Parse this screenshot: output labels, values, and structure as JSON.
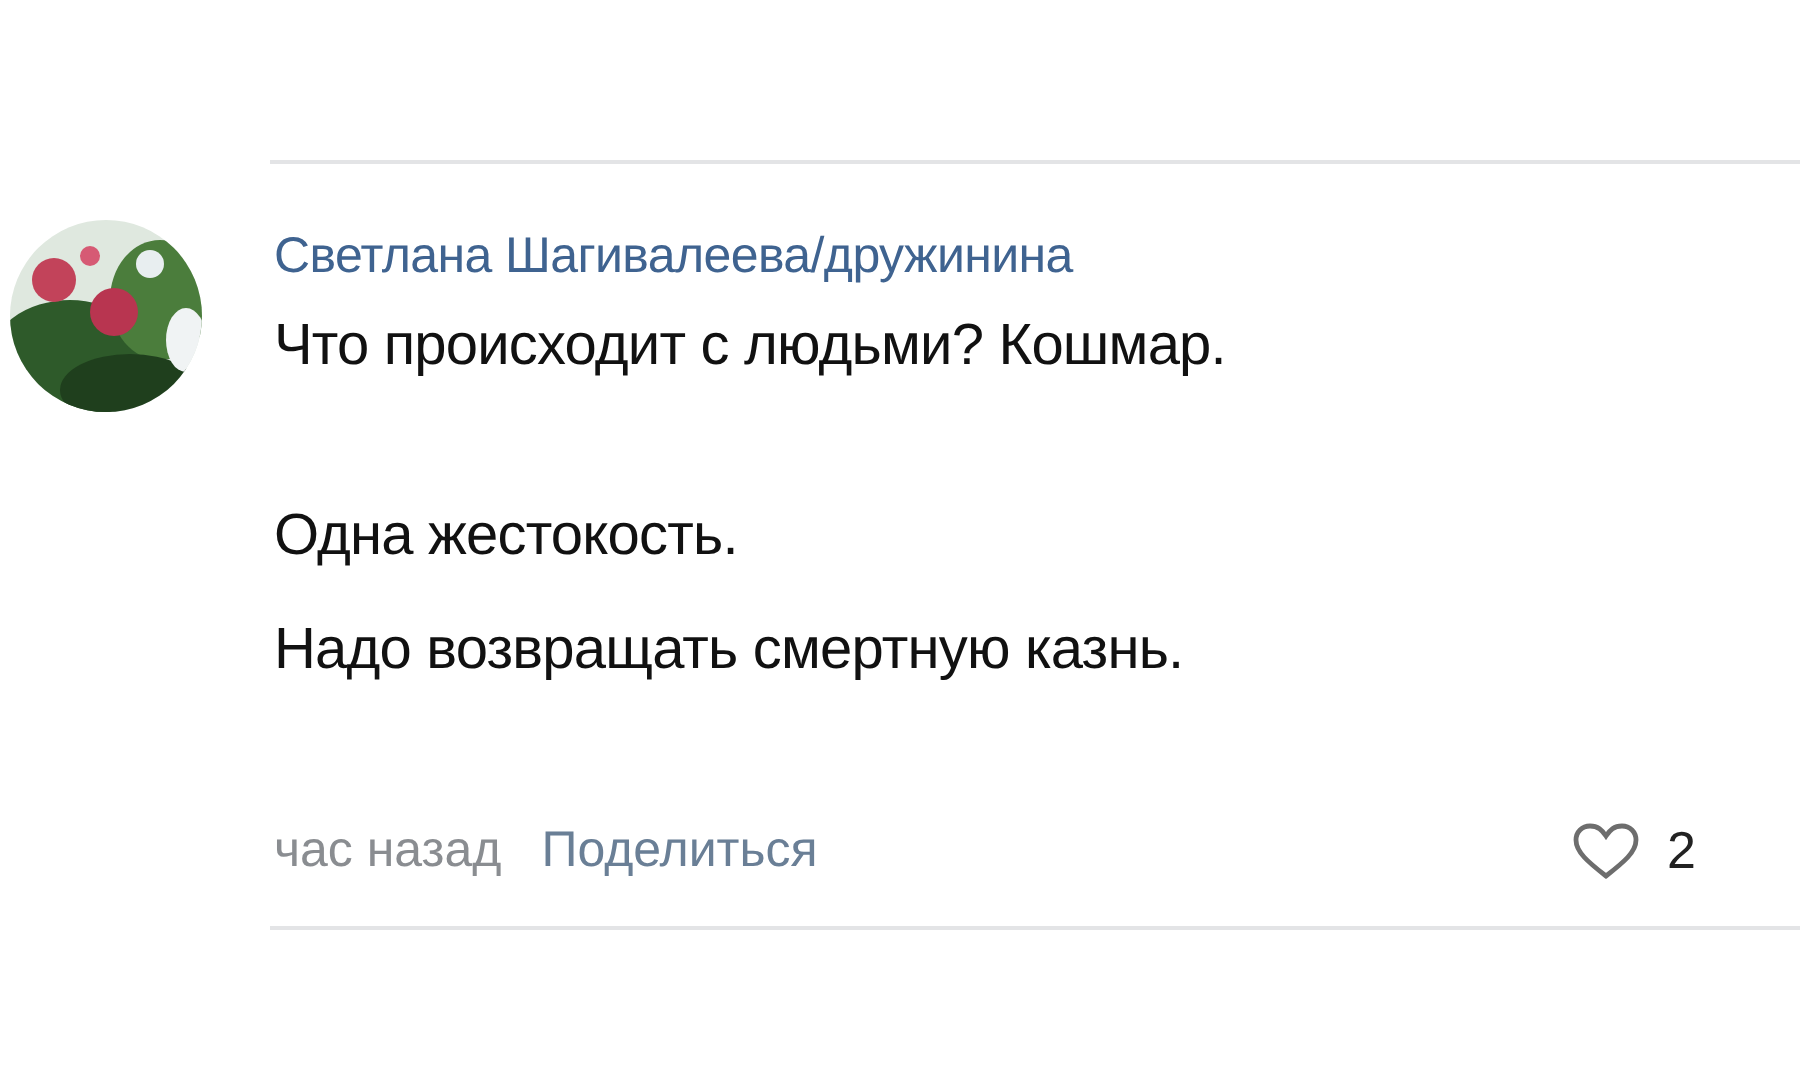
{
  "comment": {
    "author": "Светлана Шагивалеева/дружинина",
    "paragraphs": [
      "Что происходит с людьми? Кошмар.",
      "Одна жестокость.",
      "Надо возвращать смертную казнь."
    ],
    "time": "час назад",
    "share": "Поделиться",
    "likes": "2"
  }
}
